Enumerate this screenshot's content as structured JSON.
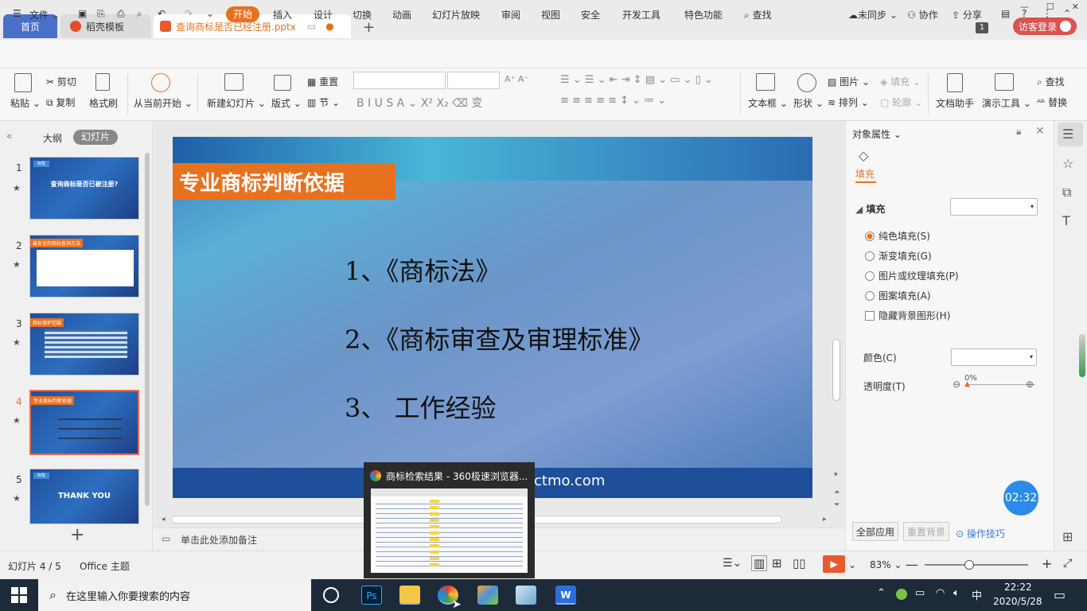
{
  "titlebar": {
    "tabs": [
      {
        "label": "首页"
      },
      {
        "label": "稻壳模板"
      },
      {
        "label": "查询商标是否已经注册.pptx"
      }
    ],
    "counter_badge": "1",
    "visitor_button": "访客登录"
  },
  "menubar": {
    "file": "文件",
    "items": [
      "开始",
      "插入",
      "设计",
      "切换",
      "动画",
      "幻灯片放映",
      "审阅",
      "视图",
      "安全",
      "开发工具",
      "特色功能"
    ],
    "search": "查找",
    "sync": "未同步",
    "collab": "协作",
    "share": "分享"
  },
  "ribbon": {
    "paste": "粘贴",
    "cut": "剪切",
    "copy": "复制",
    "format_painter": "格式刷",
    "from_start": "从当前开始",
    "new_slide": "新建幻灯片",
    "layout": "版式",
    "reset": "重置",
    "section": "节",
    "textbox": "文本框",
    "shape": "形状",
    "picture": "图片",
    "fill": "填充",
    "arrange": "排列",
    "outline": "轮廓",
    "doc_helper": "文档助手",
    "present_tools": "演示工具",
    "find": "查找",
    "replace": "替换"
  },
  "left_panel": {
    "outline_tab": "大纲",
    "slides_tab": "幻灯片",
    "thumbnails": [
      {
        "num": "1",
        "title": "查询商标是否已被注册?",
        "tag": "标签"
      },
      {
        "num": "2",
        "title": "最安全的商标查询方法"
      },
      {
        "num": "3",
        "title": "商标保护范围"
      },
      {
        "num": "4",
        "title": "专业商标判断依据"
      },
      {
        "num": "5",
        "title": "THANK YOU",
        "tag": "标签"
      }
    ]
  },
  "slide": {
    "title": "专业商标判断依据",
    "items": [
      "1、《商标法》",
      "2、《商标审查及审理标准》",
      "3、 工作经验"
    ],
    "url_fragment": "ctmo.com"
  },
  "notes_placeholder": "单击此处添加备注",
  "right_panel": {
    "header": "对象属性",
    "tab_fill": "填充",
    "section_fill": "填充",
    "options": [
      "纯色填充(S)",
      "渐变填充(G)",
      "图片或纹理填充(P)",
      "图案填充(A)"
    ],
    "hide_bg": "隐藏背景图形(H)",
    "color_label": "颜色(C)",
    "transparency_label": "透明度(T)",
    "transparency_value": "0%",
    "apply_all": "全部应用",
    "reset_bg": "重置背景",
    "tips": "操作技巧",
    "timer": "02:32"
  },
  "statusbar": {
    "slide_info": "幻灯片 4 / 5",
    "theme": "Office 主题",
    "zoom": "83%"
  },
  "popup": {
    "title": "商标检索结果 - 360极速浏览器..."
  },
  "taskbar": {
    "search_placeholder": "在这里输入你要搜索的内容",
    "ime": "中",
    "time": "22:22",
    "date": "2020/5/28"
  }
}
